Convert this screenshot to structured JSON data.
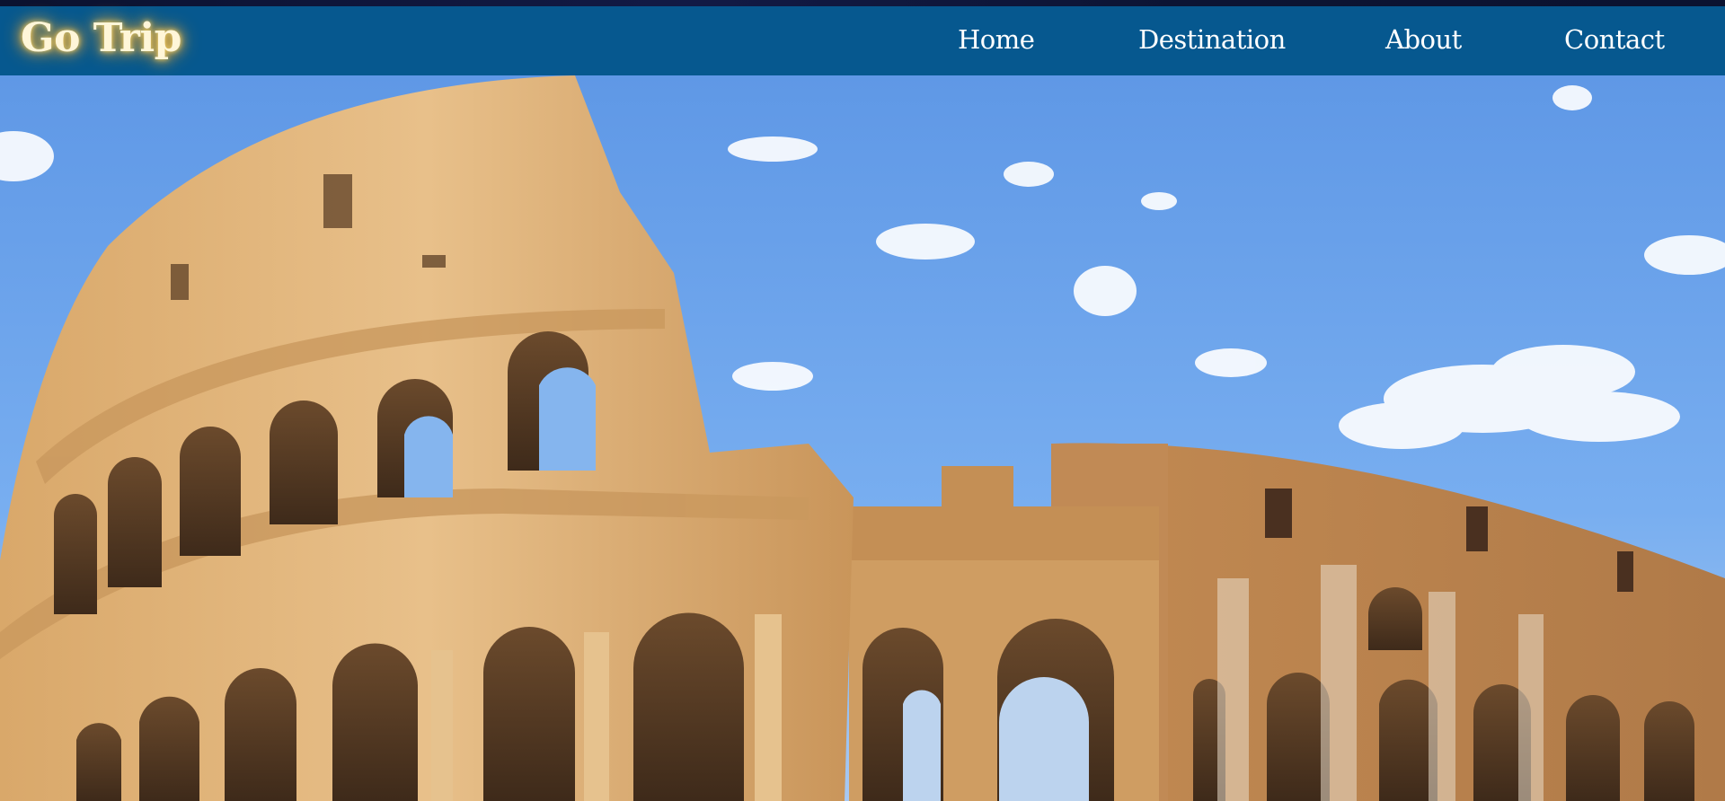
{
  "brand": {
    "logo_text": "Go Trip"
  },
  "nav": {
    "items": [
      {
        "label": "Home"
      },
      {
        "label": "Destination"
      },
      {
        "label": "About"
      },
      {
        "label": "Contact"
      }
    ]
  },
  "hero": {
    "image_subject": "colosseum-photo"
  },
  "colors": {
    "navbar": "#06588f",
    "logo_glow": "#f3b23b",
    "nav_text": "#ffffff",
    "sky": "#6aa2ea"
  }
}
